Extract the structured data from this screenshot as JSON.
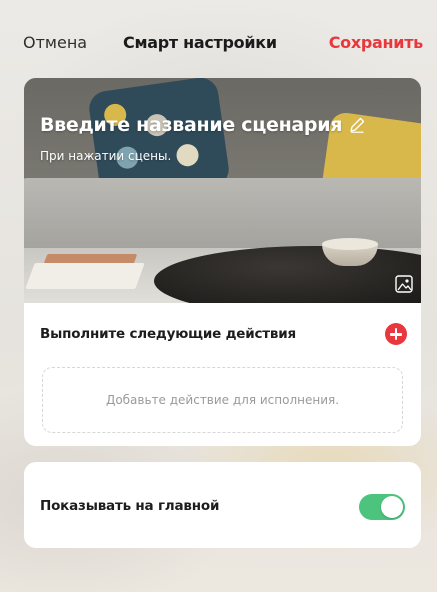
{
  "navbar": {
    "cancel_label": "Отмена",
    "title": "Смарт настройки",
    "save_label": "Сохранить"
  },
  "scene": {
    "name_placeholder": "Введите название сценария",
    "subtitle": "При нажатии  сцены."
  },
  "actions": {
    "title": "Выполните следующие действия",
    "empty_placeholder": "Добавьте действие для исполнения."
  },
  "home_toggle": {
    "label": "Показывать на главной",
    "enabled": true
  },
  "colors": {
    "accent_red": "#e8383d",
    "toggle_green": "#4cc47e"
  },
  "icons": {
    "edit": "pencil-icon",
    "cover": "image-icon",
    "add": "plus-circle-icon"
  }
}
